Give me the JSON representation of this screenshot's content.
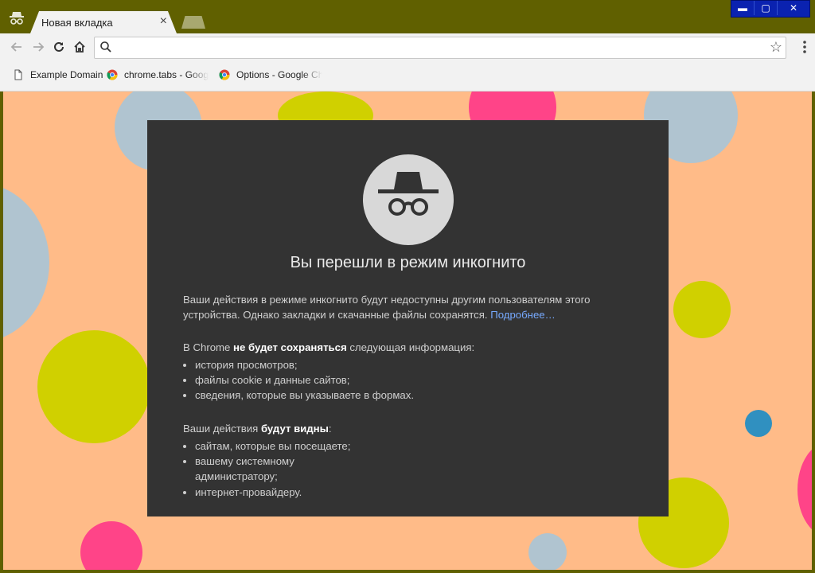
{
  "window": {
    "tab_title": "Новая вкладка",
    "tab_close": "×",
    "controls": {
      "minimize": "▬",
      "maximize": "▢",
      "close": "✕"
    }
  },
  "toolbar": {
    "back": "←",
    "forward": "→",
    "omnibox_value": "",
    "omnibox_placeholder": "",
    "star": "☆"
  },
  "bookmarks": [
    {
      "label": "Example Domain",
      "icon": "page-icon"
    },
    {
      "label": "chrome.tabs - Google",
      "icon": "chrome-icon"
    },
    {
      "label": "Options - Google Chr",
      "icon": "chrome-icon"
    }
  ],
  "incognito": {
    "headline": "Вы перешли в режим инкогнито",
    "intro_text": "Ваши действия в режиме инкогнито будут недоступны другим пользователям этого устройства. Однако закладки и скачанные файлы сохранятся.",
    "learn_more": "Подробнее…",
    "not_saved_prefix": "В Chrome ",
    "not_saved_bold": "не будет сохраняться",
    "not_saved_suffix": " следующая информация:",
    "not_saved_items": [
      "история просмотров;",
      "файлы cookie и данные сайтов;",
      "сведения, которые вы указываете в формах."
    ],
    "visible_prefix": "Ваши действия ",
    "visible_bold": "будут видны",
    "visible_suffix": ":",
    "visible_items": [
      "сайтам, которые вы посещаете;",
      "вашему системному администратору;",
      "интернет-провайдеру."
    ]
  },
  "theme": {
    "frame": "#606000",
    "page_bg": "#ffbb88",
    "card_bg": "#333333",
    "dot_blue": "#b0c4d0",
    "dot_yellow": "#d0d000",
    "dot_pink": "#ff4488",
    "dot_teal": "#3090c0"
  }
}
